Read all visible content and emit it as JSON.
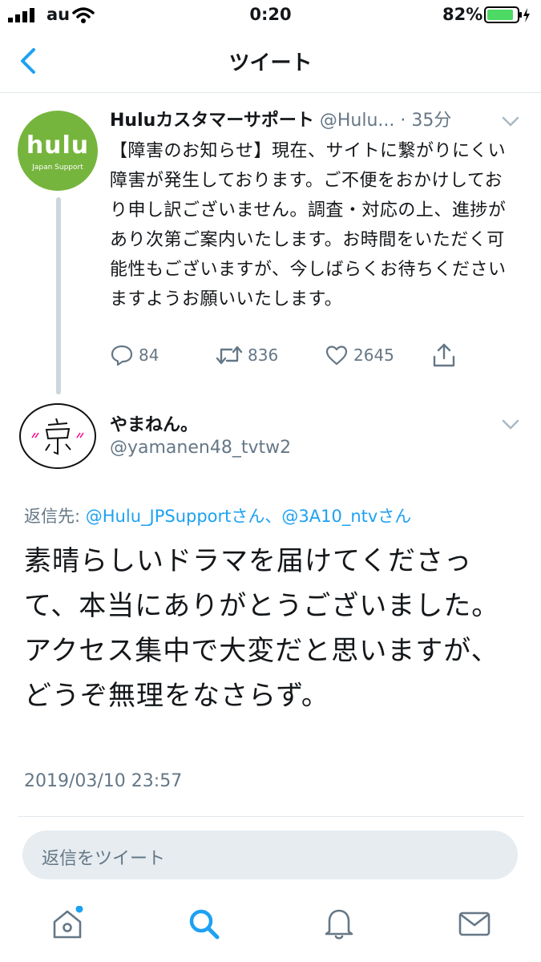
{
  "status_bar": {
    "carrier": "au",
    "time": "0:20",
    "battery": "82%",
    "battery_color": "#4cd964"
  },
  "nav": {
    "title": "ツイート",
    "back_icon": "chevron-left-icon"
  },
  "tweet1": {
    "avatar_text": "hulu",
    "avatar_sub": "Japan Support",
    "avatar_color": "#76b53d",
    "name": "Huluカスタマーサポート",
    "handle": "@Hulu...",
    "time": "· 35分",
    "body": "【障害のお知らせ】現在、サイトに繋がりにくい障害が発生しております。ご不便をおかけしており申し訳ございません。調査・対応の上、進捗があり次第ご案内いたします。お時間をいただく可能性もございますが、今しばらくお待ちくださいますようお願いいたします。",
    "replies": "84",
    "retweets": "836",
    "likes": "2645"
  },
  "tweet2": {
    "name": "やまねん。",
    "handle": "@yamanen48_tvtw2",
    "reply_prefix": "返信先: ",
    "reply_mentions": "@Hulu_JPSupportさん、@3A10_ntvさん",
    "body": "素晴らしいドラマを届けてくださって、本当にありがとうございました。アクセス集中で大変だと思いますが、どうぞ無理をなさらず。",
    "date": "2019/03/10 23:57"
  },
  "reply_input": {
    "placeholder": "返信をツイート"
  },
  "colors": {
    "accent": "#1da1f2",
    "secondary_text": "#657786",
    "divider": "#e1e8ed"
  }
}
